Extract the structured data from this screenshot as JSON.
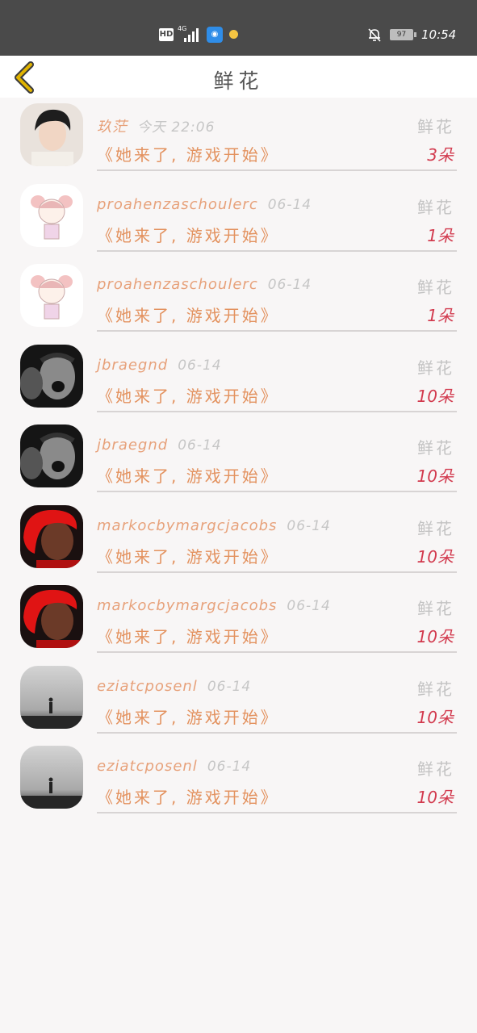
{
  "status_bar": {
    "hd": "HD",
    "network": "4G",
    "app_icon": "tmall-icon",
    "battery": "97",
    "time": "10:54"
  },
  "header": {
    "title": "鲜花",
    "back_icon": "chevron-left-icon",
    "accent_color": "#e0b300"
  },
  "items": [
    {
      "user": "玖茫",
      "time": "今天 22:06",
      "type": "鲜花",
      "book": "《她来了, 游戏开始》",
      "count": "3朵",
      "avatar": "young-man-photo"
    },
    {
      "user": "proahenzaschoulerc",
      "time": "06-14",
      "type": "鲜花",
      "book": "《她来了, 游戏开始》",
      "count": "1朵",
      "avatar": "anime-girl-sketch"
    },
    {
      "user": "proahenzaschoulerc",
      "time": "06-14",
      "type": "鲜花",
      "book": "《她来了, 游戏开始》",
      "count": "1朵",
      "avatar": "anime-girl-sketch"
    },
    {
      "user": "jbraegnd",
      "time": "06-14",
      "type": "鲜花",
      "book": "《她来了, 游戏开始》",
      "count": "10朵",
      "avatar": "bw-shouting-man"
    },
    {
      "user": "jbraegnd",
      "time": "06-14",
      "type": "鲜花",
      "book": "《她来了, 游戏开始》",
      "count": "10朵",
      "avatar": "bw-shouting-man"
    },
    {
      "user": "markocbymargcjacobs",
      "time": "06-14",
      "type": "鲜花",
      "book": "《她来了, 游戏开始》",
      "count": "10朵",
      "avatar": "red-hair-man"
    },
    {
      "user": "markocbymargcjacobs",
      "time": "06-14",
      "type": "鲜花",
      "book": "《她来了, 游戏开始》",
      "count": "10朵",
      "avatar": "red-hair-man"
    },
    {
      "user": "eziatcposenl",
      "time": "06-14",
      "type": "鲜花",
      "book": "《她来了, 游戏开始》",
      "count": "10朵",
      "avatar": "foggy-figure"
    },
    {
      "user": "eziatcposenl",
      "time": "06-14",
      "type": "鲜花",
      "book": "《她来了, 游戏开始》",
      "count": "10朵",
      "avatar": "foggy-figure"
    }
  ]
}
